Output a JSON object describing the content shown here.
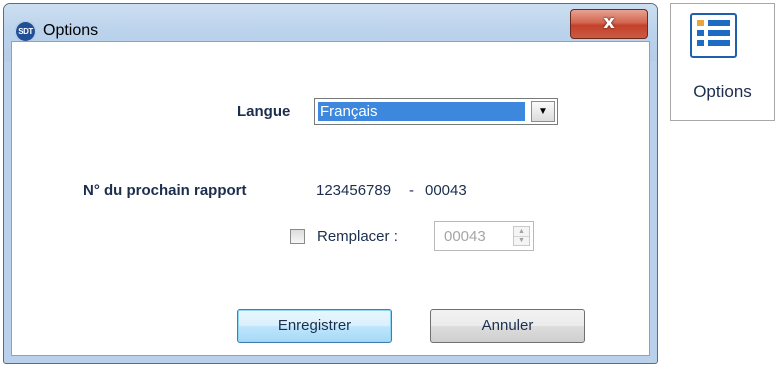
{
  "window": {
    "title": "Options",
    "app_icon_text": "SDT",
    "close_label": "x"
  },
  "form": {
    "language_label": "Langue",
    "language_value": "Français",
    "report_label": "N° du prochain rapport",
    "report_number": "123456789",
    "report_separator": "-",
    "report_suffix": "00043",
    "replace_label": "Remplacer :",
    "replace_checked": false,
    "replace_value": "00043"
  },
  "buttons": {
    "save": "Enregistrer",
    "cancel": "Annuler"
  },
  "ribbon": {
    "options_label": "Options"
  },
  "icons": {
    "app": "sdt-logo-icon",
    "close": "close-icon",
    "dropdown": "chevron-down-icon",
    "spin_up": "spin-up-icon",
    "spin_down": "spin-down-icon",
    "options": "options-list-icon"
  }
}
